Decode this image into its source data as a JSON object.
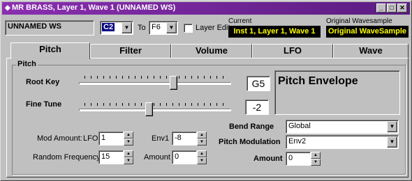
{
  "window": {
    "title": "MR BRASS, Layer 1, Wave 1 (UNNAMED WS)",
    "title_icon": "app-icon",
    "controls": [
      "_",
      "□",
      "✕"
    ]
  },
  "toolbar": {
    "wave_name": "UNNAMED WS",
    "from_key": "C2",
    "to_label": "To",
    "to_key": "F6",
    "layer_edit_label": "Layer Edit",
    "layer_edit_checked": false,
    "current_label": "Current",
    "current_value": "Inst 1, Layer 1, Wave 1",
    "original_label": "Original Wavesample",
    "original_value": "Original WaveSample"
  },
  "tabs": [
    {
      "label": "Pitch",
      "active": true
    },
    {
      "label": "Filter",
      "active": false
    },
    {
      "label": "Volume",
      "active": false
    },
    {
      "label": "LFO",
      "active": false
    },
    {
      "label": "Wave",
      "active": false
    }
  ],
  "pitch": {
    "group_title": "Pitch",
    "root_key_label": "Root Key",
    "root_key_value": "G5",
    "root_key_level": 0.62,
    "fine_tune_label": "Fine Tune",
    "fine_tune_value": "-2",
    "fine_tune_level": 0.46,
    "envelope_title": "Pitch Envelope",
    "mod_amount_label": "Mod Amount:",
    "lfo_label": "LFO",
    "lfo_value": "1",
    "env1_label": "Env1",
    "env1_value": "-8",
    "random_frequency_label": "Random Frequency",
    "random_frequency_value": "15",
    "amount_label": "Amount",
    "amount_value": "0",
    "bend_range_label": "Bend Range",
    "bend_range_value": "Global",
    "pitch_modulation_label": "Pitch Modulation",
    "pitch_modulation_value": "Env2",
    "amount2_label": "Amount",
    "amount2_value": "0"
  },
  "colors": {
    "titlebar_start": "#8a2fb0",
    "titlebar_end": "#5a1c80",
    "highlight_text": "#ffff00",
    "highlight_bg": "#000000",
    "selected_bg": "#000080"
  }
}
